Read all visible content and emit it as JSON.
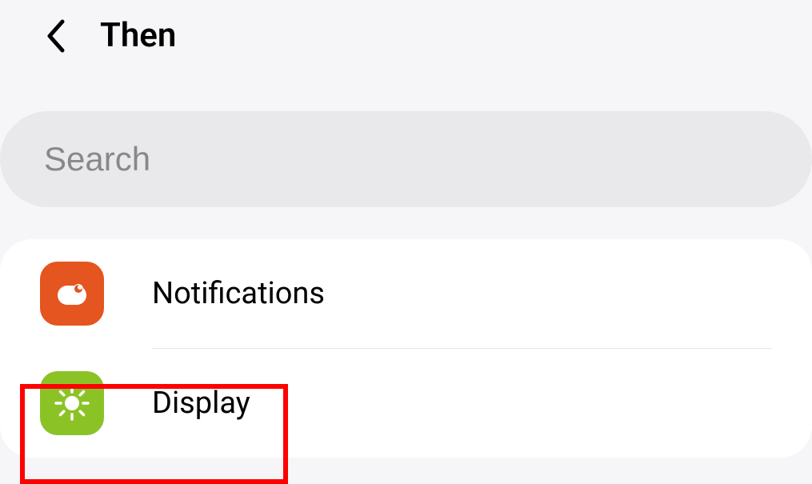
{
  "header": {
    "title": "Then"
  },
  "search": {
    "placeholder": "Search",
    "value": ""
  },
  "items": [
    {
      "label": "Notifications",
      "icon": "notifications"
    },
    {
      "label": "Display",
      "icon": "display"
    }
  ],
  "colors": {
    "notifications": "#e4551f",
    "display": "#8bc327",
    "highlight": "#ff0000"
  }
}
